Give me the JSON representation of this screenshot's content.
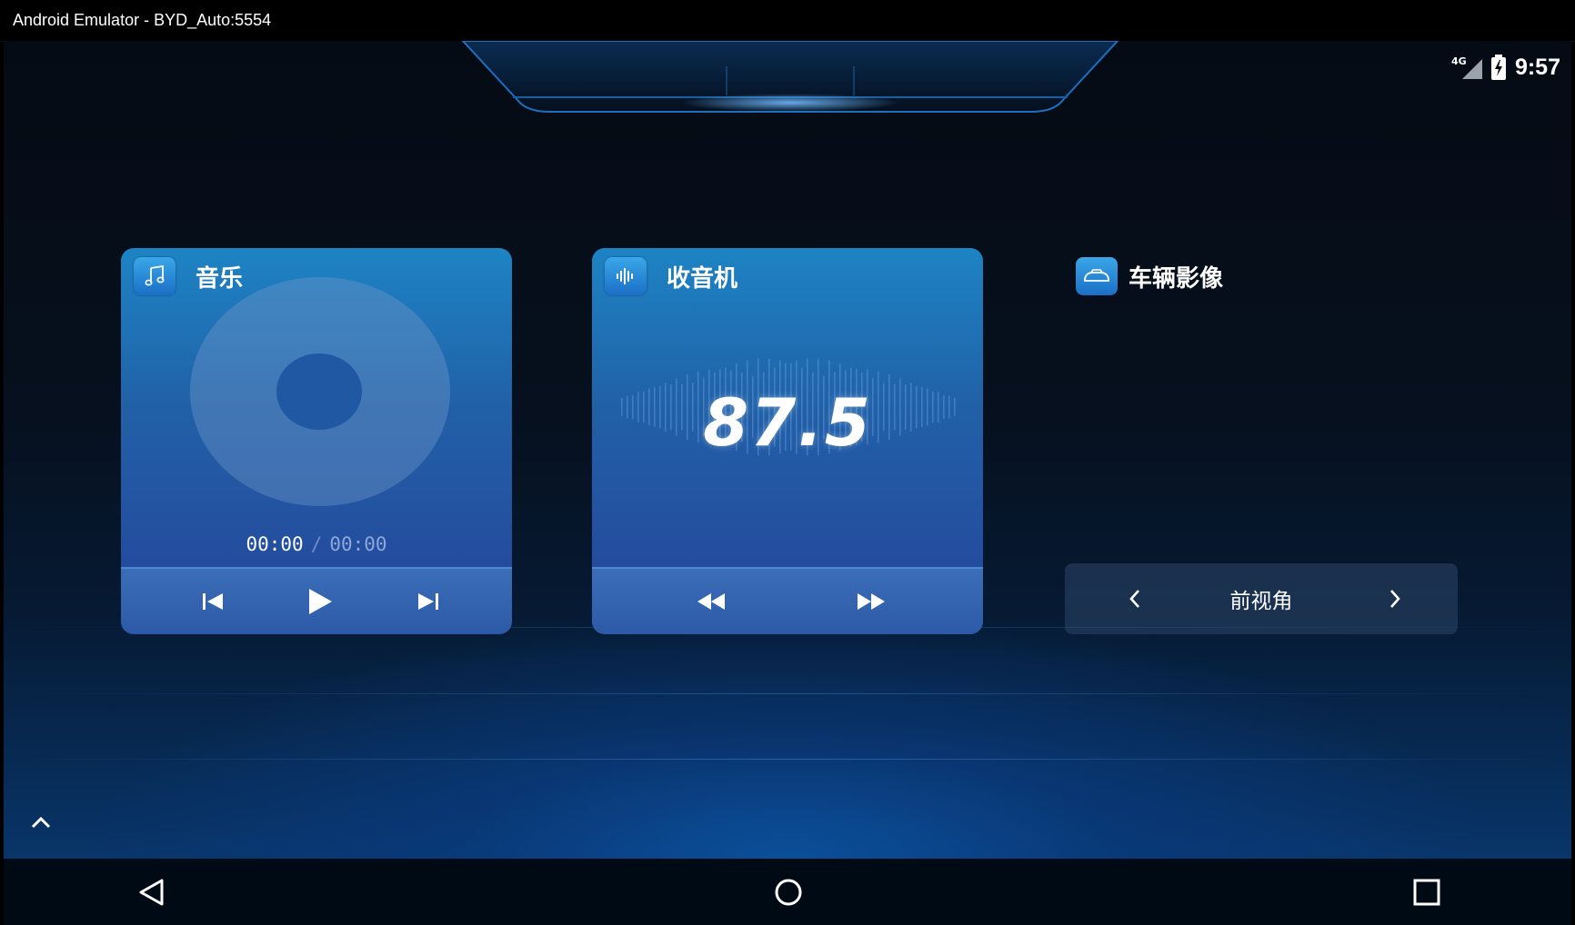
{
  "window": {
    "title": "Android Emulator - BYD_Auto:5554"
  },
  "status_bar": {
    "network": "4G",
    "time": "9:57"
  },
  "music": {
    "title": "音乐",
    "current_time": "00:00",
    "separator": "/",
    "total_time": "00:00"
  },
  "radio": {
    "title": "收音机",
    "frequency": "87.5"
  },
  "vehicle_camera": {
    "title": "车辆影像",
    "view_label": "前视角"
  },
  "colors": {
    "card_top": "#1d84c4",
    "card_bottom": "#26439a",
    "accent": "#2a8fe0"
  },
  "icons": [
    "music-note-icon",
    "radio-wave-icon",
    "car-icon",
    "previous-track-icon",
    "play-icon",
    "next-track-icon",
    "rewind-icon",
    "fast-forward-icon",
    "chevron-left-icon",
    "chevron-right-icon",
    "chevron-up-icon",
    "back-icon",
    "home-icon",
    "recents-icon",
    "signal-icon",
    "battery-icon"
  ]
}
